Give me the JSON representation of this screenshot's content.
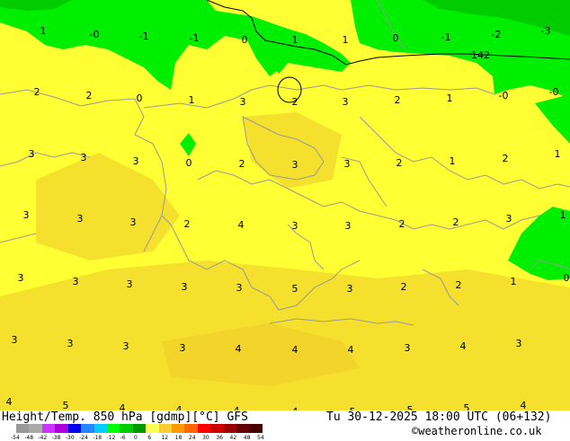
{
  "footer": {
    "title": "Height/Temp. 850 hPa [gdmp][°C] GFS",
    "datetime": "Tu 30-12-2025 18:00 UTC (06+132)",
    "credit": "©weatheronline.co.uk"
  },
  "colorbar": {
    "ticks": [
      "-54",
      "-48",
      "-42",
      "-38",
      "-30",
      "-24",
      "-18",
      "-12",
      "-6",
      "0",
      "6",
      "12",
      "18",
      "24",
      "30",
      "36",
      "42",
      "48",
      "54"
    ],
    "colors": [
      "#999999",
      "#aaaaaa",
      "#cc33ff",
      "#aa00dd",
      "#0000ee",
      "#2288ff",
      "#00ccff",
      "#00ff00",
      "#00cc00",
      "#009900",
      "#ffff55",
      "#ffcc33",
      "#ff9900",
      "#ff6600",
      "#ff0000",
      "#cc0000",
      "#990000",
      "#660000",
      "#440000"
    ]
  },
  "contour": {
    "label": "142"
  },
  "temps": [
    {
      "t": "1"
    },
    {
      "t": "-0"
    },
    {
      "t": "-1"
    },
    {
      "t": "-1"
    },
    {
      "t": "0"
    },
    {
      "t": "1"
    },
    {
      "t": "1"
    },
    {
      "t": "0"
    },
    {
      "t": "-1"
    },
    {
      "t": "-2"
    },
    {
      "t": "-3"
    },
    {
      "t": "2"
    },
    {
      "t": "2"
    },
    {
      "t": "0"
    },
    {
      "t": "1"
    },
    {
      "t": "3"
    },
    {
      "t": "2"
    },
    {
      "t": "3"
    },
    {
      "t": "2"
    },
    {
      "t": "1"
    },
    {
      "t": "-0"
    },
    {
      "t": "-0"
    },
    {
      "t": "3"
    },
    {
      "t": "3"
    },
    {
      "t": "3"
    },
    {
      "t": "0"
    },
    {
      "t": "2"
    },
    {
      "t": "3"
    },
    {
      "t": "3"
    },
    {
      "t": "2"
    },
    {
      "t": "1"
    },
    {
      "t": "2"
    },
    {
      "t": "1"
    },
    {
      "t": "3"
    },
    {
      "t": "3"
    },
    {
      "t": "3"
    },
    {
      "t": "2"
    },
    {
      "t": "4"
    },
    {
      "t": "3"
    },
    {
      "t": "3"
    },
    {
      "t": "2"
    },
    {
      "t": "2"
    },
    {
      "t": "3"
    },
    {
      "t": "1"
    },
    {
      "t": "3"
    },
    {
      "t": "3"
    },
    {
      "t": "3"
    },
    {
      "t": "3"
    },
    {
      "t": "3"
    },
    {
      "t": "5"
    },
    {
      "t": "3"
    },
    {
      "t": "2"
    },
    {
      "t": "2"
    },
    {
      "t": "1"
    },
    {
      "t": "0"
    },
    {
      "t": "3"
    },
    {
      "t": "3"
    },
    {
      "t": "3"
    },
    {
      "t": "3"
    },
    {
      "t": "4"
    },
    {
      "t": "4"
    },
    {
      "t": "4"
    },
    {
      "t": "3"
    },
    {
      "t": "4"
    },
    {
      "t": "3"
    },
    {
      "t": "4"
    },
    {
      "t": "5"
    },
    {
      "t": "4"
    },
    {
      "t": "4"
    },
    {
      "t": "4"
    },
    {
      "t": "4"
    },
    {
      "t": "5"
    },
    {
      "t": "5"
    },
    {
      "t": "5"
    },
    {
      "t": "4"
    }
  ]
}
